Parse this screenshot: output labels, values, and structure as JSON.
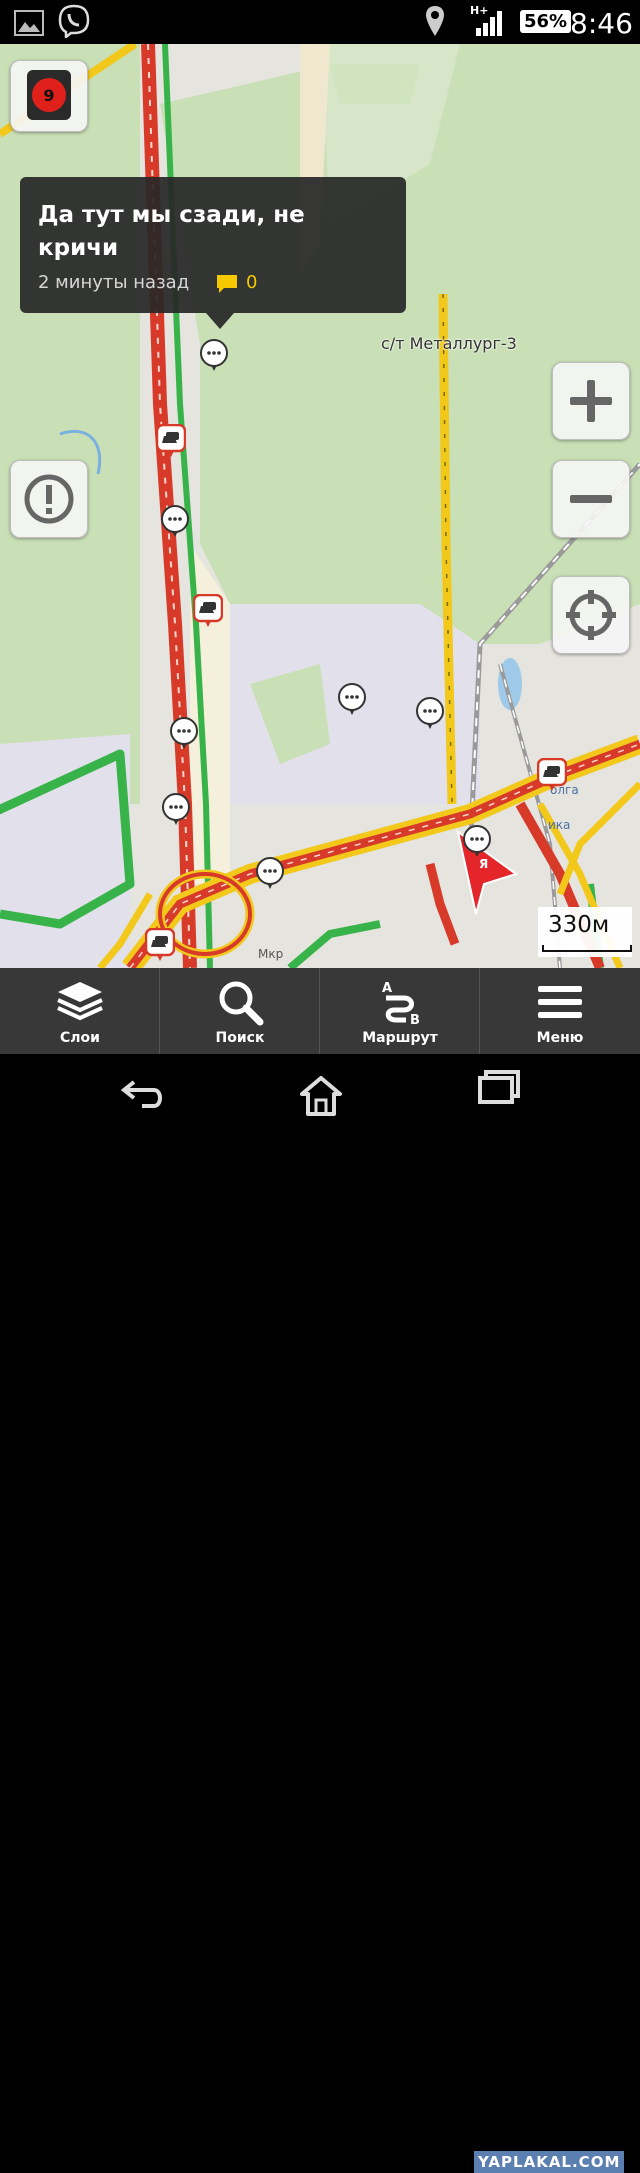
{
  "status_bar": {
    "network": "H+",
    "battery": "56%",
    "time": "8:46",
    "icons": [
      "image-icon",
      "viber-icon",
      "location-icon",
      "signal-icon",
      "battery-icon"
    ]
  },
  "map": {
    "place_label": "с/т Металлург-3",
    "scale": "330м",
    "traffic_level": "9",
    "partial_labels": [
      "олга",
      "ика",
      "Мкр"
    ],
    "user_marker": "Я"
  },
  "event_popup": {
    "title": "Да тут мы сзади, не кричи",
    "time": "2 минуты назад",
    "comment_count": "0"
  },
  "toolbar": {
    "layers_label": "Слои",
    "search_label": "Поиск",
    "route_label": "Маршрут",
    "menu_label": "Меню"
  },
  "watermark": "YAPLAKAL.COM",
  "colors": {
    "traffic_red": "#d83a2a",
    "traffic_yellow": "#f2c81a",
    "traffic_green": "#37b34a",
    "map_green": "#c9dfb6",
    "popup_bg": "#282828",
    "comment_accent": "#f6c800"
  }
}
